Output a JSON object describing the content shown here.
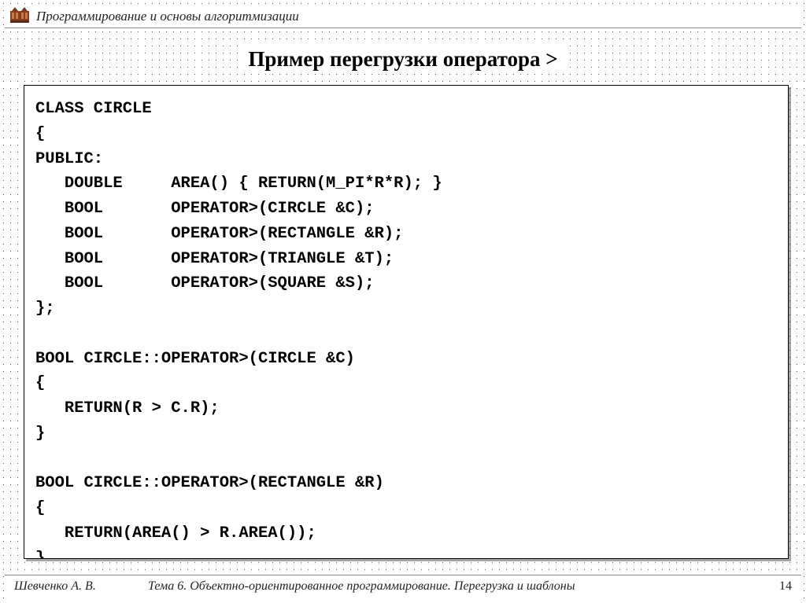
{
  "header": {
    "course_title": "Программирование и основы алгоритмизации"
  },
  "slide": {
    "title": "Пример перегрузки оператора >"
  },
  "code": {
    "text": "class Circle\n{\npublic:\n   double     Area() { return(M_PI*r*r); }\n   bool       operator>(Circle &C);\n   bool       operator>(Rectangle &R);\n   bool       operator>(Triangle &T);\n   bool       operator>(Square &S);\n};\n\nbool Circle::operator>(Circle &C)\n{\n   return(r > C.r);\n}\n\nbool Circle::operator>(Rectangle &R)\n{\n   return(Area() > R.Area());\n}"
  },
  "footer": {
    "author": "Шевченко А. В.",
    "theme": "Тема 6. Объектно-ориентированное программирование. Перегрузка и шаблоны",
    "page": "14"
  }
}
